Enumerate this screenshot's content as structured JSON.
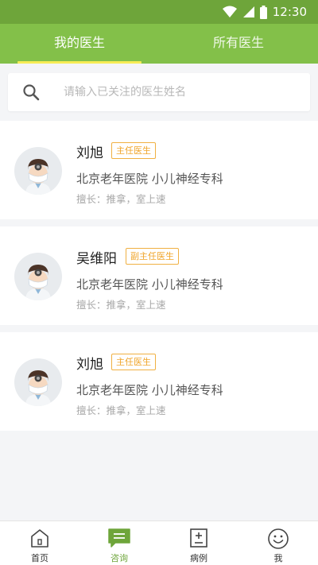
{
  "status_bar": {
    "time": "12:30"
  },
  "tabs": [
    {
      "label": "我的医生",
      "active": true
    },
    {
      "label": "所有医生",
      "active": false
    }
  ],
  "search": {
    "placeholder": "请输入已关注的医生姓名"
  },
  "doctors": [
    {
      "name": "刘旭",
      "title": "主任医生",
      "hospital": "北京老年医院  小儿神经专科",
      "skills": "擅长：推拿，室上速"
    },
    {
      "name": "吴维阳",
      "title": "副主任医生",
      "hospital": "北京老年医院  小儿神经专科",
      "skills": "擅长：推拿，室上速"
    },
    {
      "name": "刘旭",
      "title": "主任医生",
      "hospital": "北京老年医院  小儿神经专科",
      "skills": "擅长：推拿，室上速"
    }
  ],
  "bottom_nav": [
    {
      "label": "首页",
      "icon": "home-icon",
      "active": false
    },
    {
      "label": "咨询",
      "icon": "chat-icon",
      "active": true
    },
    {
      "label": "病例",
      "icon": "medical-record-icon",
      "active": false
    },
    {
      "label": "我",
      "icon": "smiley-icon",
      "active": false
    }
  ],
  "colors": {
    "status_bar": "#6ea53a",
    "header": "#83c049",
    "tab_indicator": "#f7ec55",
    "badge": "#f0a52b",
    "nav_active": "#6ea53a"
  }
}
